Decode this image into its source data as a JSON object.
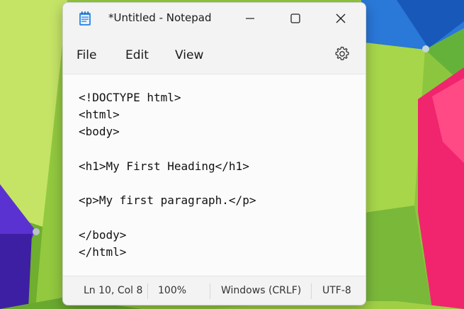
{
  "window": {
    "title": "*Untitled - Notepad"
  },
  "titlebar": {
    "app_icon": "notepad-icon",
    "minimize_icon": "minimize-icon",
    "maximize_icon": "maximize-icon",
    "close_icon": "close-icon"
  },
  "menu": {
    "items": [
      {
        "label": "File"
      },
      {
        "label": "Edit"
      },
      {
        "label": "View"
      }
    ],
    "settings_icon": "gear-icon"
  },
  "editor": {
    "lines": [
      "<!DOCTYPE html>",
      "<html>",
      "<body>",
      "",
      "<h1>My First Heading</h1>",
      "",
      "<p>My first paragraph.</p>",
      "",
      "</body>",
      "</html>"
    ]
  },
  "status": {
    "position": "Ln 10, Col 8",
    "zoom": "100%",
    "line_ending": "Windows (CRLF)",
    "encoding": "UTF-8"
  },
  "colors": {
    "window_bg": "#f3f3f3",
    "editor_bg": "#fbfbfb",
    "text": "#111111",
    "desktop_green": "#8cc63f",
    "desktop_blue": "#1f6fd1",
    "desktop_pink": "#f0256e",
    "desktop_purple": "#5a2bd1"
  }
}
